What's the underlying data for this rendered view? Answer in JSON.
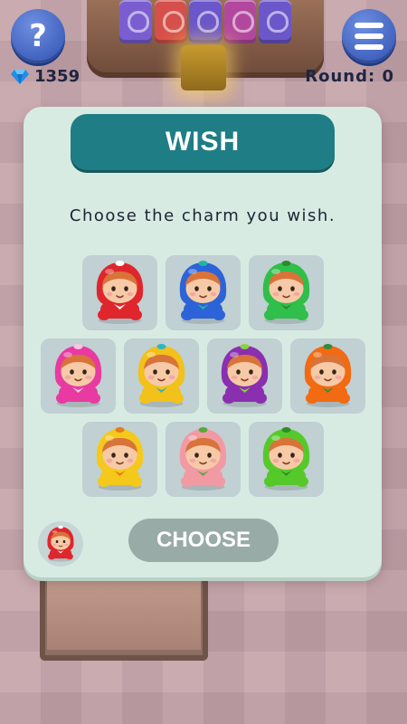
{
  "hud": {
    "help_label": "?",
    "gem_count": "1359",
    "round_label": "Round: 0"
  },
  "machine_tiles": [
    {
      "color": "#7a5ed1"
    },
    {
      "color": "#d6504b"
    },
    {
      "color": "#6b57c9"
    },
    {
      "color": "#b2489e"
    },
    {
      "color": "#6b57c9"
    }
  ],
  "modal": {
    "title": "WISH",
    "prompt": "Choose the charm you wish.",
    "choose_label": "CHOOSE"
  },
  "charms": [
    {
      "name": "Strawberry charm",
      "hood": "#e0262d",
      "accent": "#ffffff"
    },
    {
      "name": "Blueberry charm",
      "hood": "#2c63d8",
      "accent": "#1fb6a8"
    },
    {
      "name": "Green apple charm",
      "hood": "#2fbf4a",
      "accent": "#2b8a2d"
    },
    {
      "name": "Dragon fruit charm",
      "hood": "#e83aa0",
      "accent": "#f7c6e0"
    },
    {
      "name": "Mango charm",
      "hood": "#f2c11a",
      "accent": "#28b8c4"
    },
    {
      "name": "Grape charm",
      "hood": "#8a2fb0",
      "accent": "#8ad23a"
    },
    {
      "name": "Orange charm",
      "hood": "#f26a12",
      "accent": "#2e8f3a"
    },
    {
      "name": "Lemon charm",
      "hood": "#f5c81c",
      "accent": "#e77a1a"
    },
    {
      "name": "Peach charm",
      "hood": "#f29aa4",
      "accent": "#5aa83a"
    },
    {
      "name": "Lime charm",
      "hood": "#56c92a",
      "accent": "#2f8d25"
    }
  ],
  "selected": {
    "name": "Strawberry charm",
    "hood": "#e0262d",
    "accent": "#ffffff"
  },
  "colors": {
    "title_bar": "#1f7d86",
    "modal_bg": "#d7ebe3",
    "choose_disabled": "#99aba6",
    "hud_button": "#2d4fb0",
    "gem": "#1e8ee6"
  }
}
